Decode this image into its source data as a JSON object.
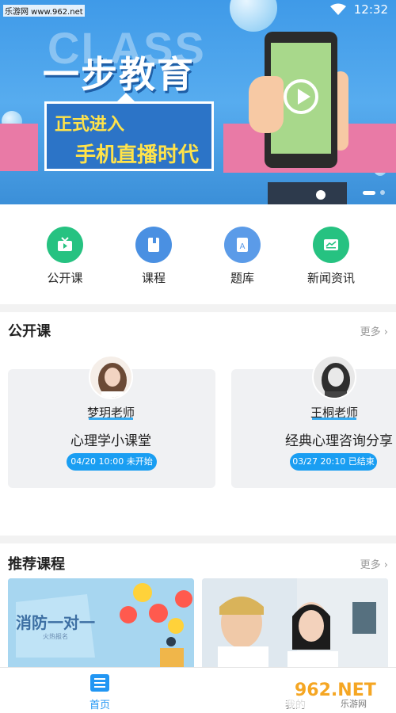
{
  "watermark_top": "乐游网 www.962.net",
  "status": {
    "time": "12:32"
  },
  "banner": {
    "bg_word": "CLASS",
    "headline": "一步教育",
    "sub_line1": "正式进入",
    "sub_line2": "手机直播时代"
  },
  "quick_nav": [
    {
      "label": "公开课",
      "icon": "tv-icon",
      "color": "#26c281"
    },
    {
      "label": "课程",
      "icon": "book-icon",
      "color": "#4a90e2"
    },
    {
      "label": "题库",
      "icon": "question-bank-icon",
      "color": "#5b9be8"
    },
    {
      "label": "新闻资讯",
      "icon": "news-icon",
      "color": "#26c281"
    }
  ],
  "open_class": {
    "title": "公开课",
    "more": "更多 ›",
    "cards": [
      {
        "teacher": "梦玥老师",
        "lesson": "心理学小课堂",
        "badge": "04/20 10:00  未开始"
      },
      {
        "teacher": "王桐老师",
        "lesson": "经典心理咨询分享",
        "badge": "03/27 20:10  已结束"
      }
    ]
  },
  "recommended": {
    "title": "推荐课程",
    "more": "更多 ›",
    "items": [
      {
        "caption": "消防一对一",
        "small": "火热报名"
      },
      {
        "caption": ""
      }
    ]
  },
  "tabbar": {
    "home": "首页",
    "mine": "我的"
  },
  "watermark_logo": {
    "big": "962.NET",
    "small": "乐游网"
  },
  "colors": {
    "accent": "#1a9ef2",
    "banner_blue": "#4aa3ec",
    "pink": "#e97aa6"
  }
}
